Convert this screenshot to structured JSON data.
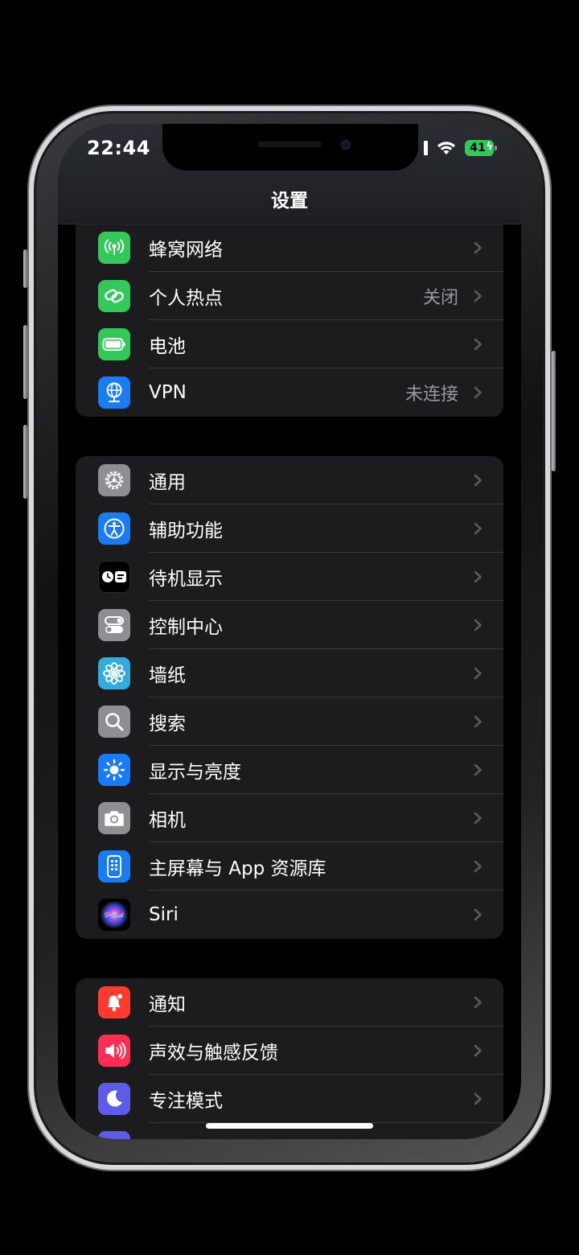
{
  "status": {
    "time": "22:44",
    "battery": "41"
  },
  "nav": {
    "title": "设置"
  },
  "colors": {
    "green": "#34c759",
    "blue": "#1a7cf5",
    "gray": "#8e8e93",
    "red": "#ff3b30",
    "pink": "#ff2d55",
    "purple": "#5e5ce6"
  },
  "groups": [
    {
      "items": [
        {
          "label": "蜂窝网络",
          "value": "",
          "icon": "antenna-icon"
        },
        {
          "label": "个人热点",
          "value": "关闭",
          "icon": "hotspot-link-icon"
        },
        {
          "label": "电池",
          "value": "",
          "icon": "battery-icon"
        },
        {
          "label": "VPN",
          "value": "未连接",
          "icon": "globe-icon"
        }
      ]
    },
    {
      "items": [
        {
          "label": "通用",
          "value": "",
          "icon": "gear-icon"
        },
        {
          "label": "辅助功能",
          "value": "",
          "icon": "accessibility-icon"
        },
        {
          "label": "待机显示",
          "value": "",
          "icon": "standby-icon"
        },
        {
          "label": "控制中心",
          "value": "",
          "icon": "toggles-icon"
        },
        {
          "label": "墙纸",
          "value": "",
          "icon": "flower-icon"
        },
        {
          "label": "搜索",
          "value": "",
          "icon": "search-icon"
        },
        {
          "label": "显示与亮度",
          "value": "",
          "icon": "sun-icon"
        },
        {
          "label": "相机",
          "value": "",
          "icon": "camera-icon"
        },
        {
          "label": "主屏幕与 App 资源库",
          "value": "",
          "icon": "phone-grid-icon"
        },
        {
          "label": "Siri",
          "value": "",
          "icon": "siri-icon"
        }
      ]
    },
    {
      "items": [
        {
          "label": "通知",
          "value": "",
          "icon": "bell-icon"
        },
        {
          "label": "声效与触感反馈",
          "value": "",
          "icon": "speaker-icon"
        },
        {
          "label": "专注模式",
          "value": "",
          "icon": "moon-icon"
        }
      ]
    }
  ]
}
